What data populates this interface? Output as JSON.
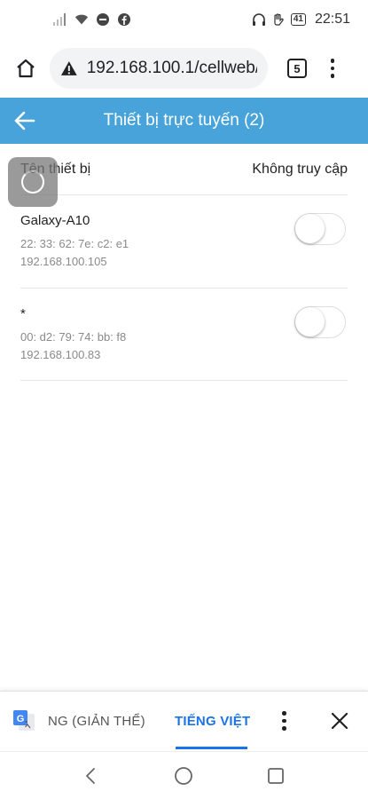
{
  "status_bar": {
    "battery": "41",
    "time": "22:51"
  },
  "browser": {
    "url": "192.168.100.1/cellweb/",
    "tab_count": "5"
  },
  "app_header": {
    "title": "Thiết bị trực tuyến (2)"
  },
  "table": {
    "col_name": "Tên thiết bị",
    "col_access": "Không truy cập"
  },
  "devices": [
    {
      "name": "Galaxy-A10",
      "mac": "22: 33: 62: 7e: c2: e1",
      "ip": "192.168.100.105",
      "blocked": false
    },
    {
      "name": "*",
      "mac": "00: d2: 79: 74: bb: f8",
      "ip": "192.168.100.83",
      "blocked": false
    }
  ],
  "translate_bar": {
    "source_lang": "NG (GIẢN THỂ)",
    "target_lang": "TIẾNG VIỆT"
  },
  "colors": {
    "header_blue": "#47a3d9",
    "accent_blue": "#1a73e8"
  }
}
